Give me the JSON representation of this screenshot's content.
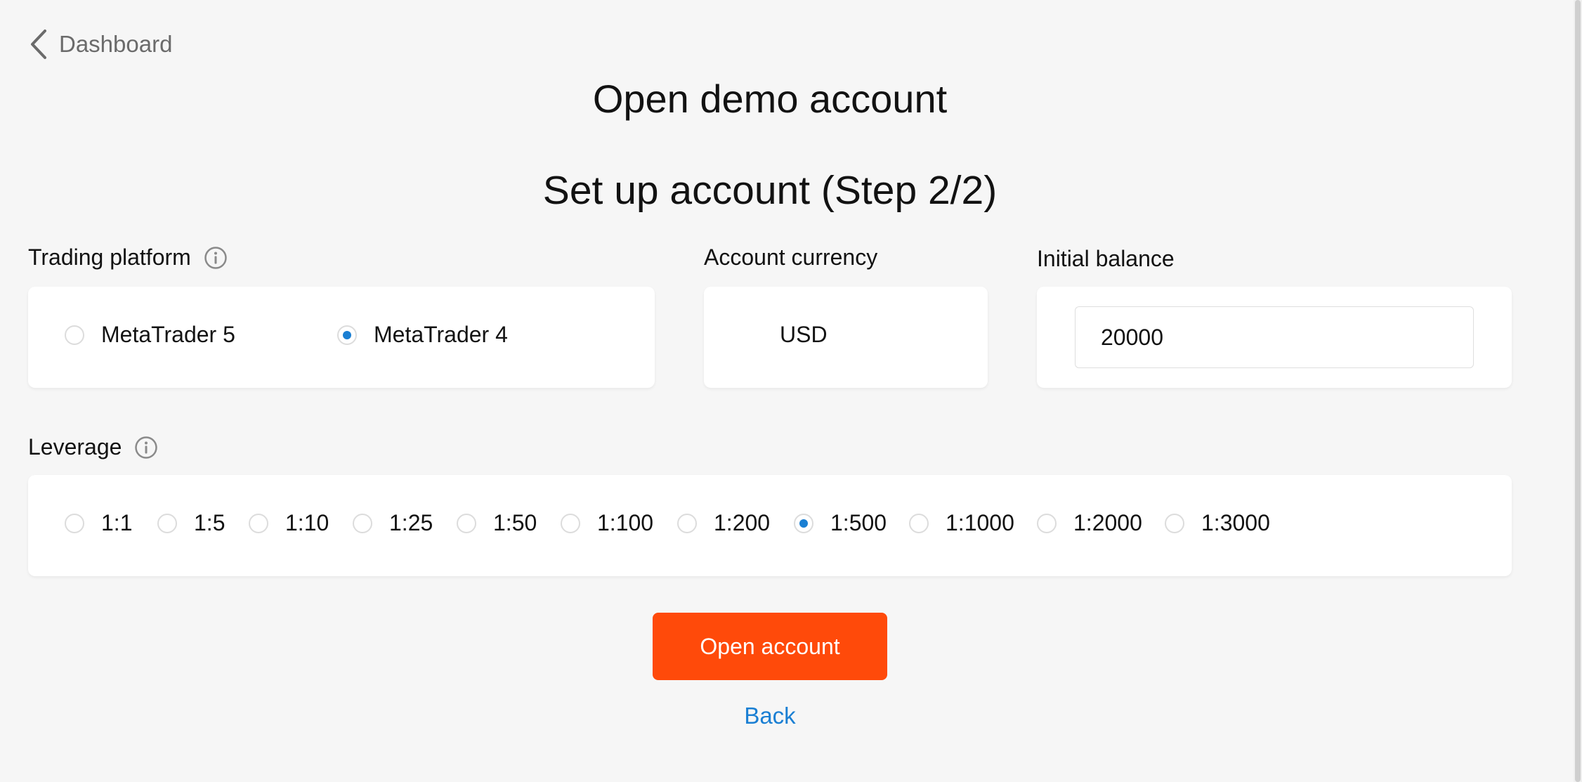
{
  "nav": {
    "back_label": "Dashboard"
  },
  "header": {
    "title": "Open demo account",
    "step_title": "Set up account (Step 2/2)"
  },
  "trading_platform": {
    "label": "Trading platform",
    "options": [
      {
        "label": "MetaTrader 5",
        "selected": false
      },
      {
        "label": "MetaTrader 4",
        "selected": true
      }
    ]
  },
  "account_currency": {
    "label": "Account currency",
    "value": "USD"
  },
  "initial_balance": {
    "label": "Initial balance",
    "value": "20000"
  },
  "leverage": {
    "label": "Leverage",
    "options": [
      {
        "label": "1:1",
        "selected": false
      },
      {
        "label": "1:5",
        "selected": false
      },
      {
        "label": "1:10",
        "selected": false
      },
      {
        "label": "1:25",
        "selected": false
      },
      {
        "label": "1:50",
        "selected": false
      },
      {
        "label": "1:100",
        "selected": false
      },
      {
        "label": "1:200",
        "selected": false
      },
      {
        "label": "1:500",
        "selected": true
      },
      {
        "label": "1:1000",
        "selected": false
      },
      {
        "label": "1:2000",
        "selected": false
      },
      {
        "label": "1:3000",
        "selected": false
      }
    ]
  },
  "actions": {
    "open_account_label": "Open account",
    "back_label": "Back"
  },
  "colors": {
    "accent_button": "#ff4a0a",
    "link_blue": "#1a7fd3",
    "background": "#f6f6f6"
  },
  "icons": {
    "back": "chevron-left-icon",
    "info": "info-icon"
  }
}
